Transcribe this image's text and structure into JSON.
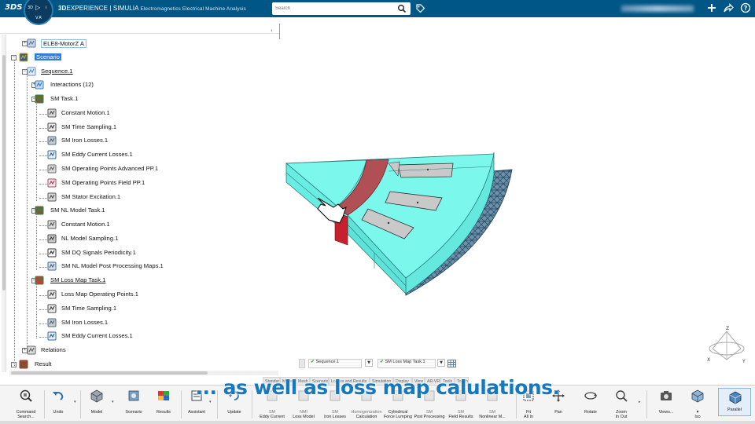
{
  "topbar": {
    "brand": "3DS",
    "compass": {
      "left": "3D",
      "center": "▷",
      "right": "i",
      "version": "V.R"
    },
    "title_prefix": "3D",
    "title_experience": "EXPERIENCE",
    "title_sep": " | ",
    "title_product": "SIMULIA",
    "title_app": "Electromagnetics Electrical Machine Analysis",
    "search_placeholder": "Search",
    "icons": [
      "search-icon",
      "tag-icon",
      "plus-icon",
      "share-icon",
      "help-icon"
    ]
  },
  "tree": [
    {
      "label": "ELE8-MotorZ A",
      "depth": 1,
      "style": "boxed",
      "icon": "part-icon",
      "expander": "+"
    },
    {
      "label": "Scenario",
      "depth": 0,
      "style": "sel",
      "icon": "scenario-icon",
      "expander": "-"
    },
    {
      "label": "Sequence.1",
      "depth": 1,
      "style": "u",
      "icon": "sequence-icon",
      "expander": "-"
    },
    {
      "label": "Interactions (12)",
      "depth": 2,
      "style": "",
      "icon": "interactions-icon",
      "expander": "+"
    },
    {
      "label": "SM Task.1",
      "depth": 2,
      "style": "",
      "icon": "task-icon",
      "expander": "-"
    },
    {
      "label": "Constant Motion.1",
      "depth": 3,
      "style": "",
      "icon": "motion-icon"
    },
    {
      "label": "SM Time Sampling.1",
      "depth": 3,
      "style": "",
      "icon": "sampling-icon"
    },
    {
      "label": "SM Iron Losses.1",
      "depth": 3,
      "style": "",
      "icon": "iron-losses-icon"
    },
    {
      "label": "SM Eddy Current Losses.1",
      "depth": 3,
      "style": "",
      "icon": "eddy-current-icon"
    },
    {
      "label": "SM Operating Points Advanced PP.1",
      "depth": 3,
      "style": "",
      "icon": "operating-points-icon"
    },
    {
      "label": "SM Operating Points Field PP.1",
      "depth": 3,
      "style": "",
      "icon": "field-pp-icon"
    },
    {
      "label": "SM Stator Excitation.1",
      "depth": 3,
      "style": "",
      "icon": "excitation-icon"
    },
    {
      "label": "SM NL Model Task.1",
      "depth": 2,
      "style": "",
      "icon": "task-icon",
      "expander": "-"
    },
    {
      "label": "Constant Motion.1",
      "depth": 3,
      "style": "",
      "icon": "motion-icon"
    },
    {
      "label": "NL Model Sampling.1",
      "depth": 3,
      "style": "",
      "icon": "nl-sampling-icon"
    },
    {
      "label": "SM DQ Signals Periodicity.1",
      "depth": 3,
      "style": "",
      "icon": "dq-signal-icon"
    },
    {
      "label": "SM NL Model Post Processing Maps.1",
      "depth": 3,
      "style": "",
      "icon": "post-processing-icon"
    },
    {
      "label": "SM Loss Map Task.1",
      "depth": 2,
      "style": "u",
      "icon": "loss-map-task-icon",
      "expander": "-"
    },
    {
      "label": "Loss Map Operating Points.1",
      "depth": 3,
      "style": "",
      "icon": "loss-map-points-icon"
    },
    {
      "label": "SM Time Sampling.1",
      "depth": 3,
      "style": "",
      "icon": "sampling-icon"
    },
    {
      "label": "SM Iron Losses.1",
      "depth": 3,
      "style": "",
      "icon": "iron-losses-icon"
    },
    {
      "label": "SM Eddy Current Losses.1",
      "depth": 3,
      "style": "",
      "icon": "eddy-current-icon"
    },
    {
      "label": "Relations",
      "depth": 1,
      "style": "",
      "icon": "relations-icon",
      "expander": "+"
    },
    {
      "label": "Result",
      "depth": 0,
      "style": "",
      "icon": "result-icon",
      "expander": "-"
    }
  ],
  "sequence_bar": {
    "sequence": "Sequence.1",
    "task": "SM Loss Map Task.1"
  },
  "tabs": [
    "Standard",
    "Model",
    "Mesh",
    "Scenario",
    "Losses and Results",
    "Simulation",
    "Display",
    "View",
    "AR-VR",
    "Tools",
    "Touch"
  ],
  "toolbar": {
    "command_search": [
      "Command",
      "Search..."
    ],
    "undo": "Undo",
    "model": "Model",
    "scenario": "Scenario",
    "results": "Results",
    "assistant": "Assistant",
    "update": "Update",
    "center_tools": [
      {
        "l1": "SM",
        "l2": "Eddy Current",
        "dim1": true
      },
      {
        "l1": "NMI",
        "l2": "Loss Model",
        "dim1": true
      },
      {
        "l1": "SM",
        "l2": "Iron Losses",
        "dim1": true
      },
      {
        "l1": "Homogenization",
        "l2": "Calculation",
        "dim1": true
      },
      {
        "l1": "Cylindrical",
        "l2": "Force Lumping",
        "dim1": false
      },
      {
        "l1": "SM",
        "l2": "Post Processing",
        "dim1": true
      },
      {
        "l1": "SM",
        "l2": "Field Results",
        "dim1": true
      },
      {
        "l1": "SM",
        "l2": "Nonlinear M...",
        "dim1": true
      }
    ],
    "fit": [
      "Fit",
      "All In"
    ],
    "pan": "Pan",
    "rotate": "Rotate",
    "zoom": [
      "Zoom",
      "In Out"
    ],
    "views": "Views...",
    "iso": "Iso",
    "parallel": "Parallel"
  },
  "compass_axes": {
    "z": "Z",
    "x": "X",
    "y": "Y"
  },
  "caption": "... as well as loss map calulations.",
  "colors": {
    "topbar": "#005685",
    "model_face": "#73f5eb",
    "magnet": "#b05055",
    "slot": "#c9c9c9",
    "mesh": "#2d5a78",
    "caption": "#1679c0"
  }
}
